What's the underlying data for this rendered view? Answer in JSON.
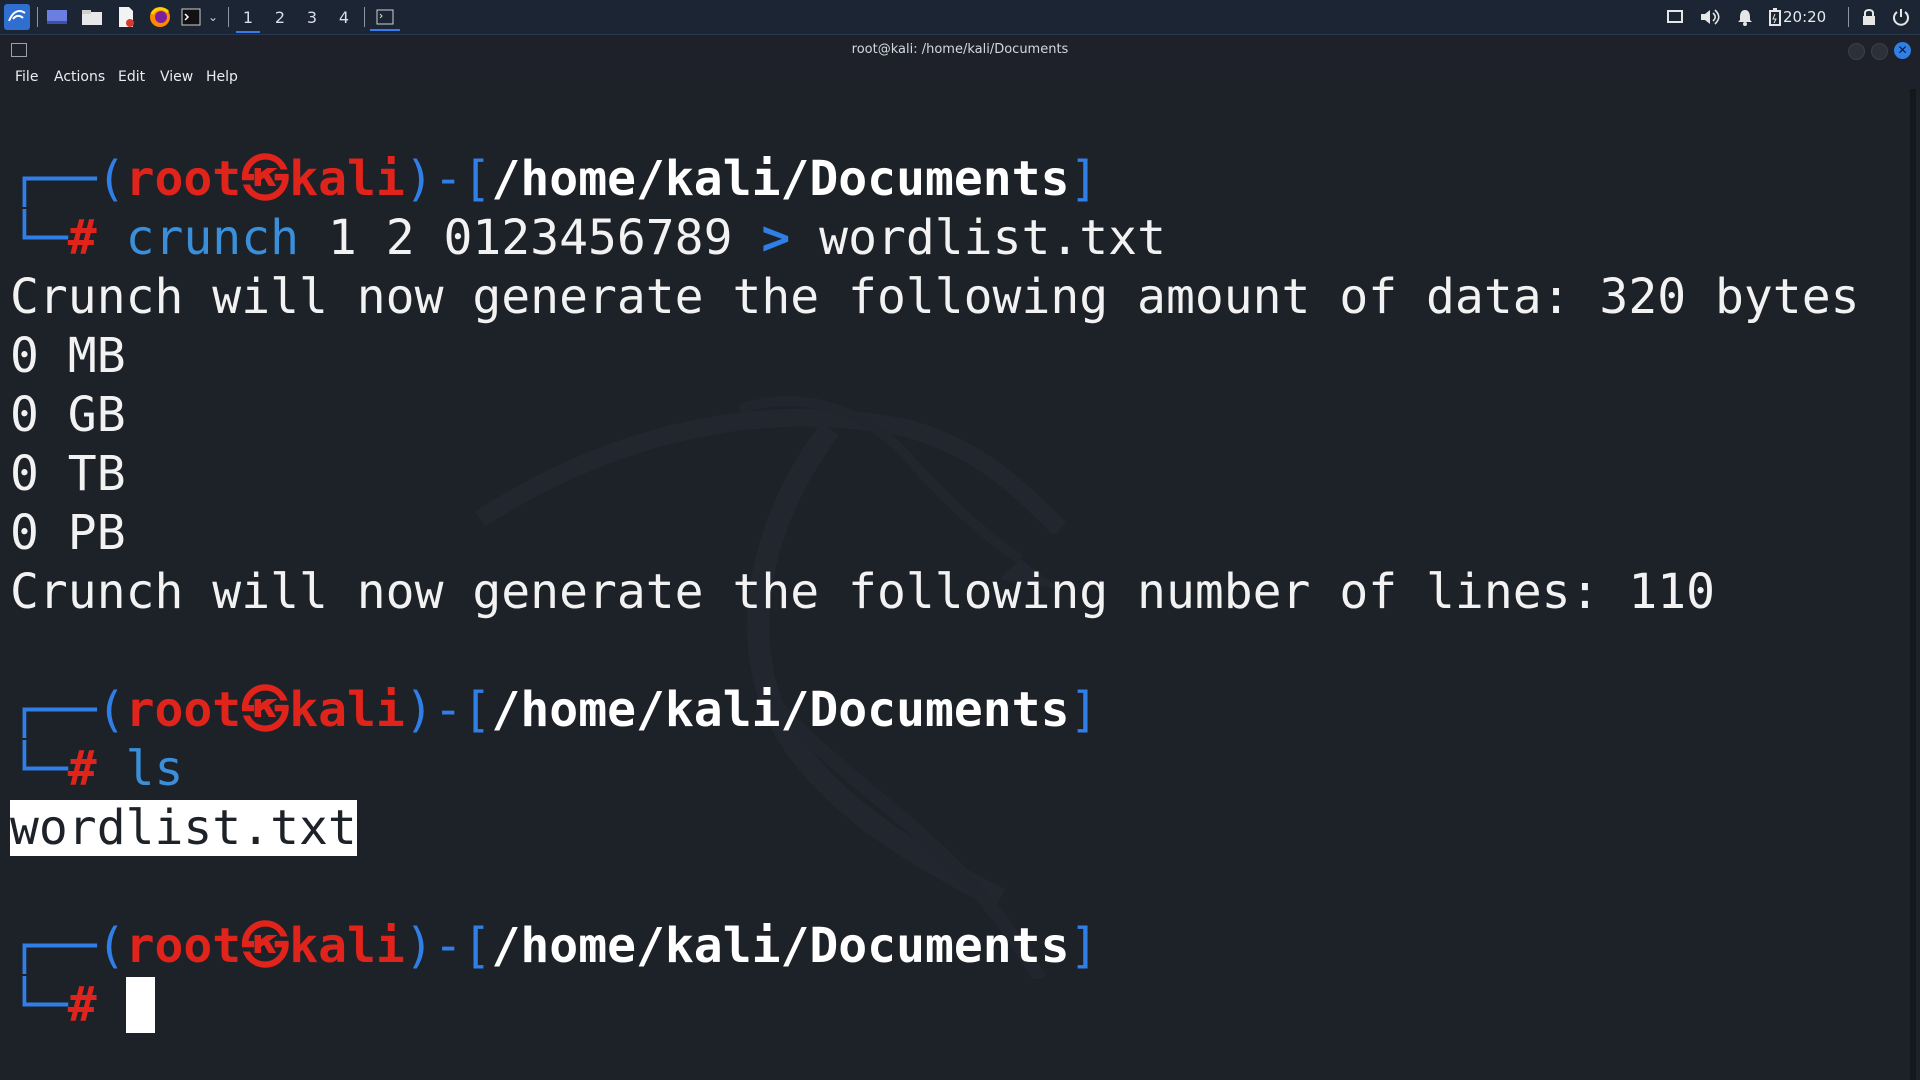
{
  "taskbar": {
    "workspaces": [
      "1",
      "2",
      "3",
      "4"
    ],
    "active_workspace": "1",
    "clock": "20:20",
    "icons": [
      "kali-menu-icon",
      "desktop-icon",
      "file-manager-icon",
      "text-editor-icon",
      "firefox-icon",
      "terminal-icon",
      "dropdown-icon",
      "terminal-window-icon",
      "display-icon",
      "volume-icon",
      "notification-bell-icon",
      "battery-icon",
      "lock-icon",
      "power-icon"
    ]
  },
  "window": {
    "title": "root@kali: /home/kali/Documents",
    "menu": [
      "File",
      "Actions",
      "Edit",
      "View",
      "Help"
    ]
  },
  "terminal": {
    "prompt": {
      "corner_top": "┌──(",
      "user": "root",
      "at": "㉿",
      "host": "kali",
      "mid": ")-[",
      "path": "/home/kali/Documents",
      "close": "]",
      "corner_bottom": "└─",
      "hash": "#"
    },
    "cmd1": {
      "name": "crunch",
      "args": " 1 2 0123456789 ",
      "redirect": ">",
      "target": " wordlist.txt"
    },
    "output1": [
      "Crunch will now generate the following amount of data: 320 bytes",
      "0 MB",
      "0 GB",
      "0 TB",
      "0 PB",
      "Crunch will now generate the following number of lines: 110"
    ],
    "cmd2": "ls",
    "output2": "wordlist.txt"
  },
  "colors": {
    "prompt_blue": "#2f7fe6",
    "prompt_red": "#e0241b",
    "background": "#1d2128"
  }
}
